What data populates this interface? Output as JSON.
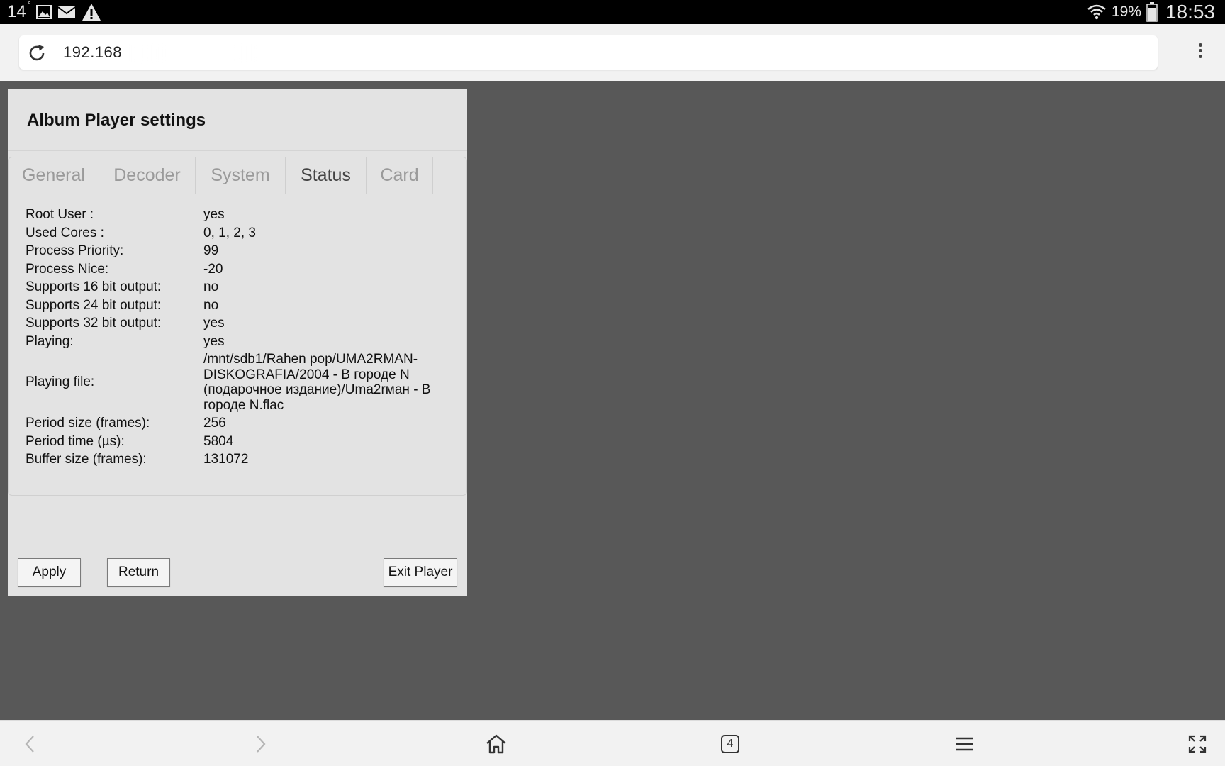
{
  "status_bar": {
    "temperature": "14",
    "degree": "°",
    "battery_percent": "19%",
    "time": "18:53",
    "icons": [
      "gallery-icon",
      "mail-icon",
      "warning-icon",
      "wifi-icon",
      "battery-icon"
    ]
  },
  "browser": {
    "url": "192.168",
    "icons": [
      "reload-icon",
      "overflow-menu-icon"
    ]
  },
  "panel": {
    "title": "Album Player settings",
    "tabs": [
      {
        "label": "General",
        "active": false
      },
      {
        "label": "Decoder",
        "active": false
      },
      {
        "label": "System",
        "active": false
      },
      {
        "label": "Status",
        "active": true
      },
      {
        "label": "Card",
        "active": false
      }
    ],
    "status_rows": [
      {
        "label": "Root User :",
        "value": "yes"
      },
      {
        "label": "Used Cores :",
        "value": "0, 1, 2, 3"
      },
      {
        "label": "Process Priority:",
        "value": "99"
      },
      {
        "label": "Process Nice:",
        "value": "-20"
      },
      {
        "label": "Supports 16 bit output:",
        "value": "no"
      },
      {
        "label": "Supports 24 bit output:",
        "value": "no"
      },
      {
        "label": "Supports 32 bit output:",
        "value": "yes"
      },
      {
        "label": "Playing:",
        "value": "yes"
      },
      {
        "label": "Playing file:",
        "value": "/mnt/sdb1/Rahen pop/UMA2RMAN-DISKOGRAFIA/2004 - В городе N (подарочное издание)/Uma2rман - В городе N.flac"
      },
      {
        "label": "Period size (frames):",
        "value": "256"
      },
      {
        "label": "Period time (µs):",
        "value": "5804"
      },
      {
        "label": "Buffer size (frames):",
        "value": "131072"
      }
    ],
    "buttons": {
      "apply": "Apply",
      "return": "Return",
      "exit": "Exit Player"
    }
  },
  "bottom_nav": {
    "tab_count": "4",
    "icons": [
      "back-arrow-icon",
      "forward-arrow-icon",
      "home-icon",
      "tabs-icon",
      "menu-icon",
      "fullscreen-icon"
    ]
  }
}
